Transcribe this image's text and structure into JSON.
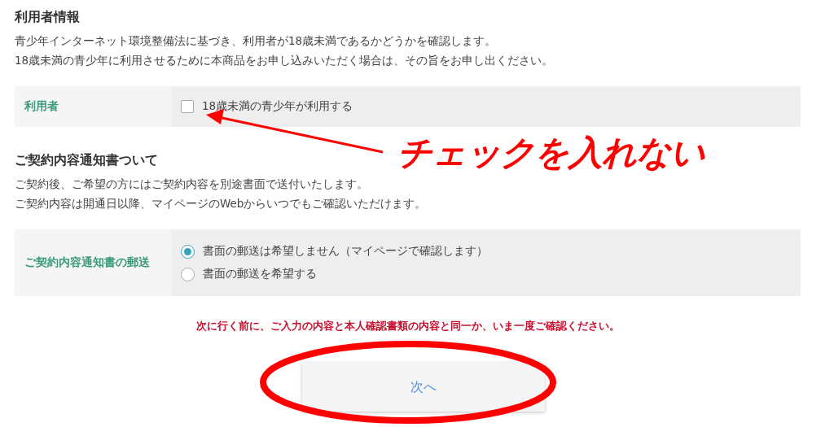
{
  "sections": [
    {
      "title": "利用者情報",
      "lines": [
        "青少年インターネット環境整備法に基づき、利用者が18歳未満であるかどうかを確認します。",
        "18歳未満の青少年に利用させるために本商品をお申し込みいただく場合は、その旨をお申し出ください。"
      ],
      "field": {
        "label": "利用者",
        "kind": "checkbox",
        "options": [
          {
            "label": "18歳未満の青少年が利用する",
            "checked": false
          }
        ]
      }
    },
    {
      "title": "ご契約内容通知書ついて",
      "lines": [
        "ご契約後、ご希望の方にはご契約内容を別途書面で送付いたします。",
        "ご契約内容は開通日以降、マイページのWebからいつでもご確認いただけます。"
      ],
      "field": {
        "label": "ご契約内容通知書の郵送",
        "kind": "radio",
        "options": [
          {
            "label": "書面の郵送は希望しません（マイページで確認します）",
            "selected": true
          },
          {
            "label": "書面の郵送を希望する",
            "selected": false
          }
        ]
      }
    }
  ],
  "warning": "次に行く前に、ご入力の内容と本人確認書類の内容と同一か、いま一度ご確認ください。",
  "next_button": "次へ",
  "annotation": "チェックを入れない"
}
